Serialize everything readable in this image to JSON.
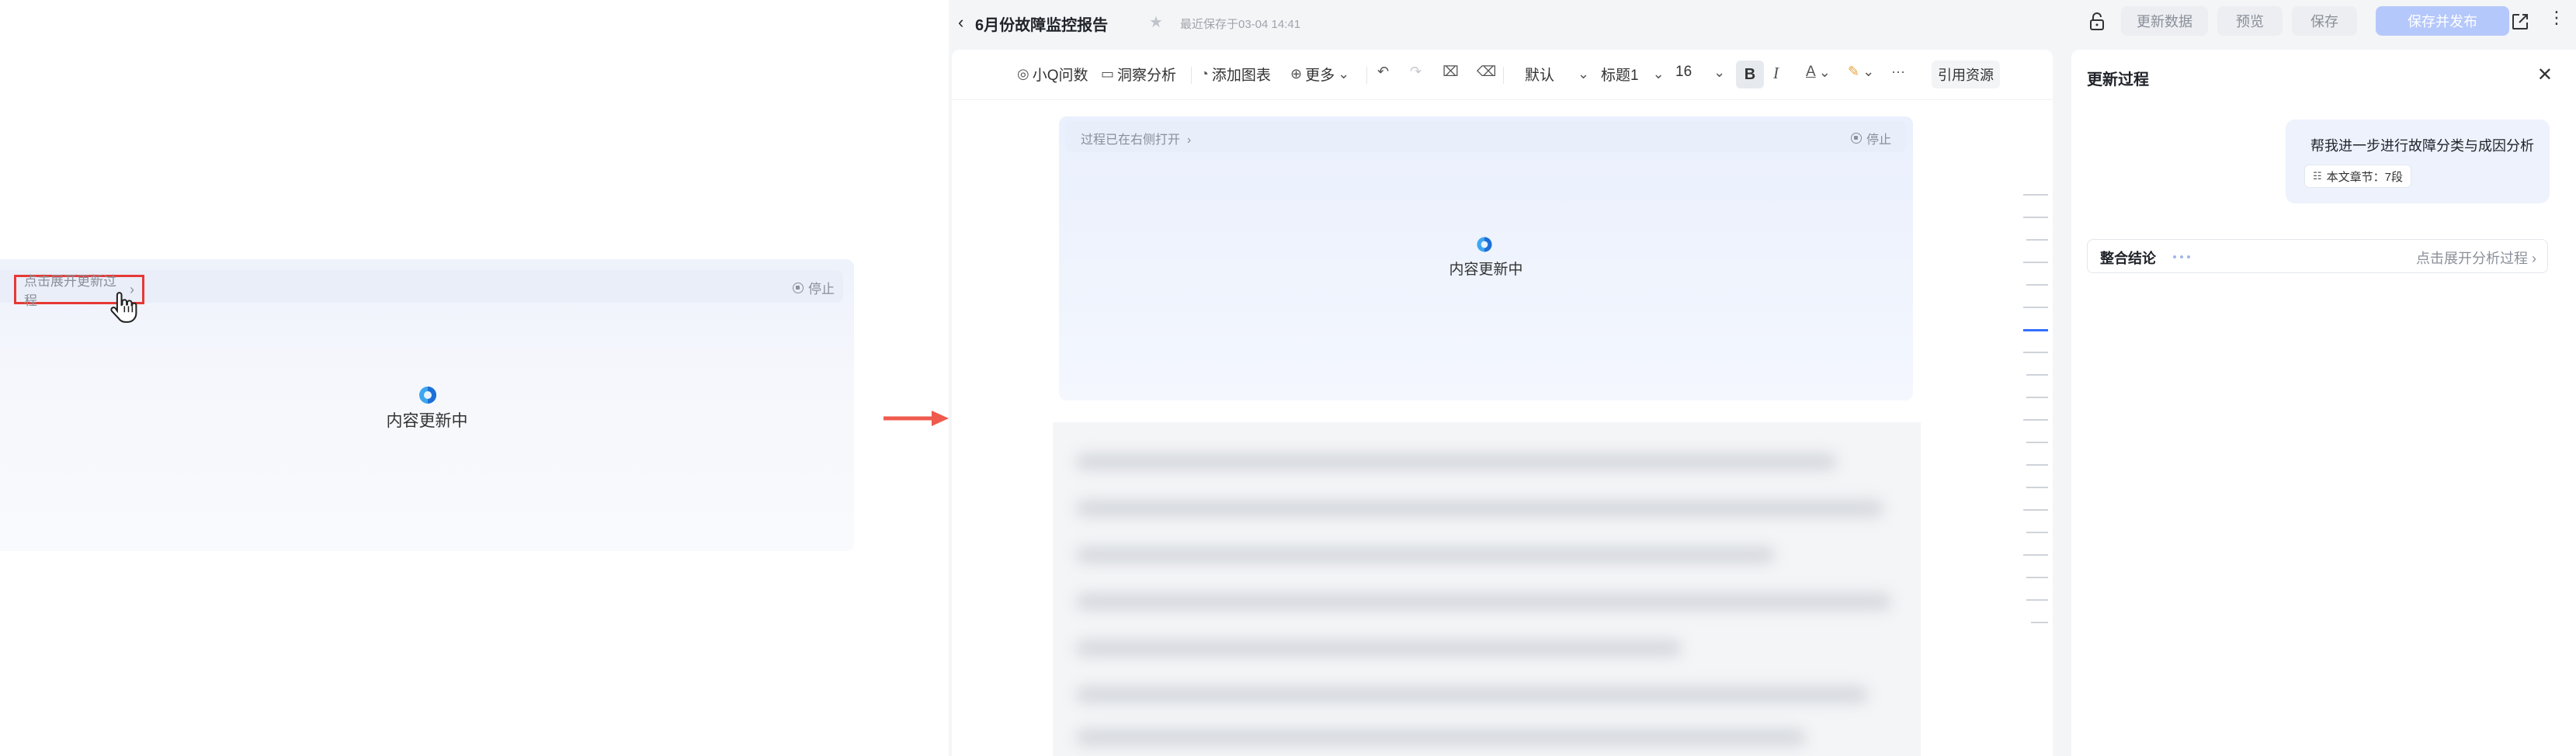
{
  "zoom": {
    "expand_label": "点击展开更新过程",
    "stop_label": "停止",
    "status": "内容更新中"
  },
  "header": {
    "back_icon": "chevron-left-icon",
    "title": "6月份故障监控报告",
    "saved_text": "最近保存于03-04 14:41",
    "buttons": {
      "update": "更新数据",
      "preview": "预览",
      "save": "保存",
      "publish": "保存并发布"
    }
  },
  "toolbar": {
    "ask": "小Q问数",
    "insight": "洞察分析",
    "add_chart": "添加图表",
    "more": "更多",
    "font": "默认",
    "heading": "标题1",
    "size": "16",
    "cite": "引用资源"
  },
  "card": {
    "note": "过程已在右侧打开",
    "stop_label": "停止",
    "status": "内容更新中"
  },
  "side": {
    "title": "更新过程",
    "message": "帮我进一步进行故障分类与成因分析",
    "chip": "本文章节：7段",
    "conclusion_label": "整合结论",
    "conclusion_link": "点击展开分析过程"
  },
  "colors": {
    "accent": "#3370ff",
    "publish_disabled": "#b5c8fb",
    "highlight_box": "#e53935",
    "arrow": "#ef5a4c"
  }
}
